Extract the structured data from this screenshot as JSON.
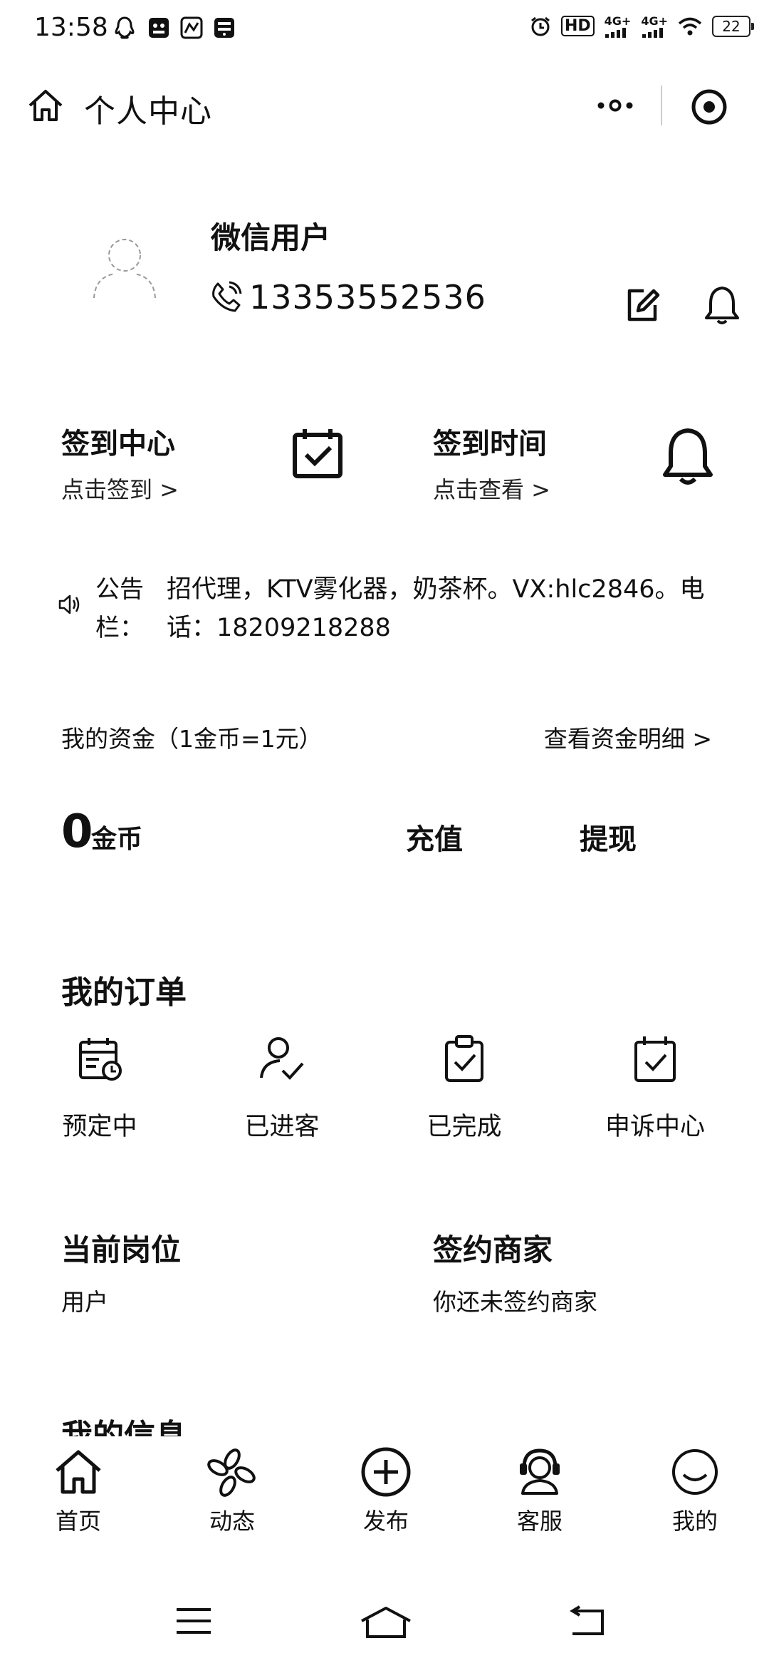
{
  "status_bar": {
    "time": "13:58",
    "network_1": "4G+",
    "network_2": "4G+",
    "hd": "HD",
    "battery": "22"
  },
  "header": {
    "title": "个人中心"
  },
  "profile": {
    "username": "微信用户",
    "phone": "13353552536"
  },
  "checkin": {
    "title": "签到中心",
    "action": "点击签到 >",
    "time_title": "签到时间",
    "time_action": "点击查看 >"
  },
  "notice": {
    "label": "公告栏：",
    "text": "招代理，KTV雾化器，奶茶杯。VX:hlc2846。电话：18209218288"
  },
  "funds": {
    "label": "我的资金（1金币=1元）",
    "detail_link": "查看资金明细 >",
    "coins": "0",
    "coin_unit": "金币",
    "recharge": "充值",
    "withdraw": "提现"
  },
  "orders": {
    "title": "我的订单",
    "items": [
      {
        "label": "预定中",
        "icon": "calendar-clock-icon"
      },
      {
        "label": "已进客",
        "icon": "user-check-icon"
      },
      {
        "label": "已完成",
        "icon": "clipboard-check-icon"
      },
      {
        "label": "申诉中心",
        "icon": "calendar-check-icon"
      }
    ]
  },
  "position": {
    "title": "当前岗位",
    "value": "用户"
  },
  "merchant": {
    "title": "签约商家",
    "value": "你还未签约商家"
  },
  "my_info": {
    "title": "我的信息"
  },
  "tabs": [
    {
      "label": "首页",
      "icon": "home-icon"
    },
    {
      "label": "动态",
      "icon": "pinwheel-icon"
    },
    {
      "label": "发布",
      "icon": "plus-circle-icon"
    },
    {
      "label": "客服",
      "icon": "headset-icon"
    },
    {
      "label": "我的",
      "icon": "smile-icon"
    }
  ]
}
